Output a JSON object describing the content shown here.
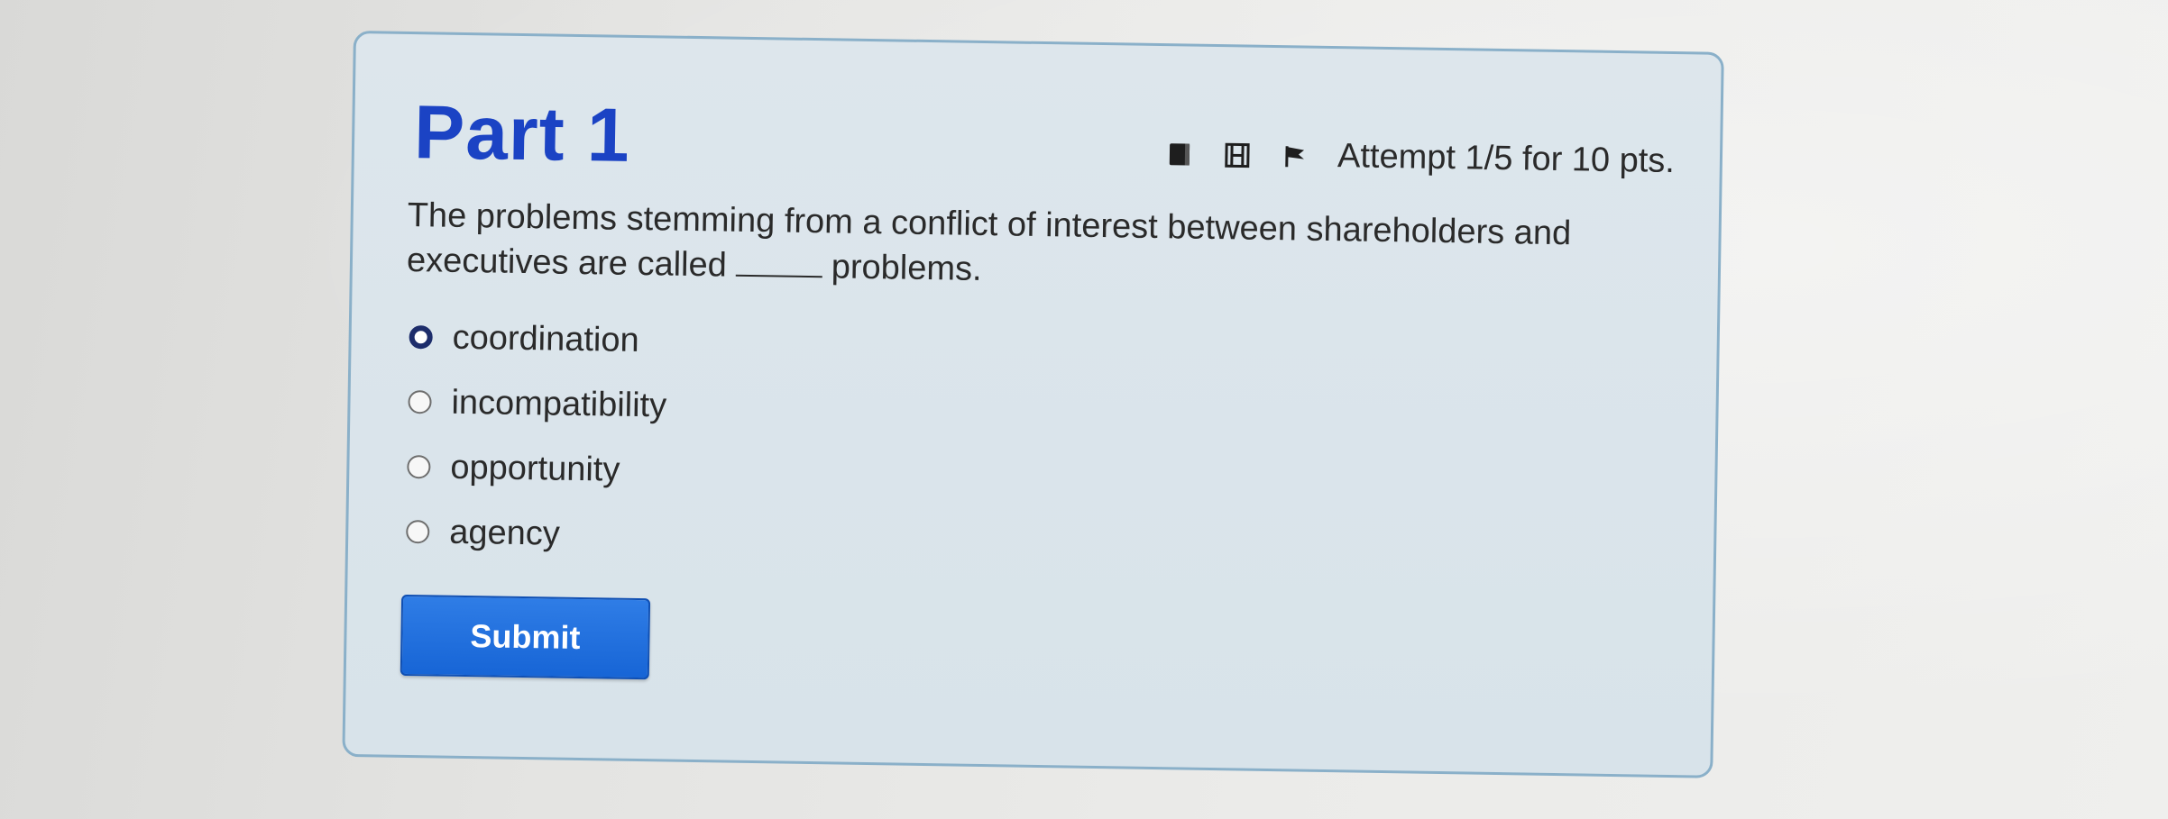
{
  "card": {
    "title": "Part 1",
    "attempt_text": "Attempt 1/5 for 10 pts.",
    "toolbar_icons": [
      "book-icon",
      "film-icon",
      "flag-icon"
    ]
  },
  "question": {
    "text_before": "The problems stemming from a conflict of interest between shareholders and executives are called",
    "text_after": "problems."
  },
  "options": [
    {
      "label": "coordination",
      "focused": true
    },
    {
      "label": "incompatibility",
      "focused": false
    },
    {
      "label": "opportunity",
      "focused": false
    },
    {
      "label": "agency",
      "focused": false
    }
  ],
  "submit_label": "Submit",
  "colors": {
    "title": "#1b43c4",
    "submit": "#1a6cdc",
    "card_border": "#8ab0c9",
    "card_bg": "#dbe5eb"
  }
}
